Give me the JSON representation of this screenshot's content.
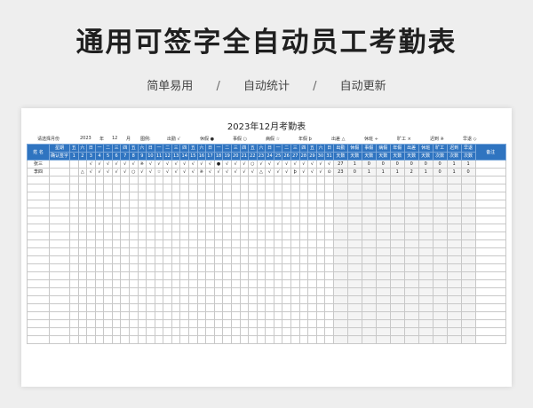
{
  "title": "通用可签字全自动员工考勤表",
  "features": [
    "简单易用",
    "自动统计",
    "自动更新"
  ],
  "separator": "/",
  "sheet": {
    "title": "2023年12月考勤表",
    "info": {
      "month_prompt": "请选择月份",
      "year_value": "2023",
      "year_label": "年",
      "month_value": "12",
      "month_label": "月",
      "legend_label": "图例:",
      "legend_items": [
        "出勤 √",
        "休假 ●",
        "事假 ○",
        "病假 ☆",
        "年假 þ",
        "出差 △",
        "休班 ÷",
        "旷工 ×",
        "迟到 ※",
        "早退 ◇"
      ]
    },
    "header": {
      "name": "姓 名",
      "weekday_label": "星期",
      "confirm_label": "确认签字",
      "weekdays": [
        "五",
        "六",
        "日",
        "一",
        "二",
        "三",
        "四",
        "五",
        "六",
        "日",
        "一",
        "二",
        "三",
        "四",
        "五",
        "六",
        "日",
        "一",
        "二",
        "三",
        "四",
        "五",
        "六",
        "日",
        "一",
        "二",
        "三",
        "四",
        "五",
        "六",
        "日"
      ],
      "days": [
        "1",
        "2",
        "3",
        "4",
        "5",
        "6",
        "7",
        "8",
        "9",
        "10",
        "11",
        "12",
        "13",
        "14",
        "15",
        "16",
        "17",
        "18",
        "19",
        "20",
        "21",
        "22",
        "23",
        "24",
        "25",
        "26",
        "27",
        "28",
        "29",
        "30",
        "31"
      ],
      "summary": [
        [
          "出勤",
          "天数"
        ],
        [
          "休假",
          "天数"
        ],
        [
          "事假",
          "天数"
        ],
        [
          "病假",
          "天数"
        ],
        [
          "年假",
          "天数"
        ],
        [
          "出差",
          "天数"
        ],
        [
          "休班",
          "天数"
        ],
        [
          "旷工",
          "次数"
        ],
        [
          "迟到",
          "次数"
        ],
        [
          "早退",
          "次数"
        ]
      ],
      "note": "备注"
    },
    "rows": [
      {
        "name": "张三",
        "marks": [
          "",
          "",
          "√",
          "√",
          "√",
          "√",
          "√",
          "√",
          "※",
          "√",
          "√",
          "√",
          "√",
          "√",
          "√",
          "√",
          "√",
          "●",
          "√",
          "√",
          "√",
          "○",
          "√",
          "√",
          "√",
          "√",
          "√",
          "√",
          "√",
          "√",
          "√"
        ],
        "summary": [
          "27",
          "1",
          "0",
          "0",
          "0",
          "0",
          "0",
          "0",
          "1",
          "1"
        ]
      },
      {
        "name": "李四",
        "marks": [
          "",
          "△",
          "√",
          "√",
          "√",
          "√",
          "√",
          "○",
          "√",
          "√",
          "☆",
          "√",
          "√",
          "√",
          "√",
          "※",
          "√",
          "√",
          "√",
          "√",
          "√",
          "√",
          "△",
          "√",
          "√",
          "√",
          "þ",
          "√",
          "√",
          "√",
          "⊙"
        ],
        "summary": [
          "23",
          "0",
          "1",
          "1",
          "1",
          "2",
          "1",
          "0",
          "1",
          "0"
        ]
      }
    ],
    "empty_rows": 21
  }
}
